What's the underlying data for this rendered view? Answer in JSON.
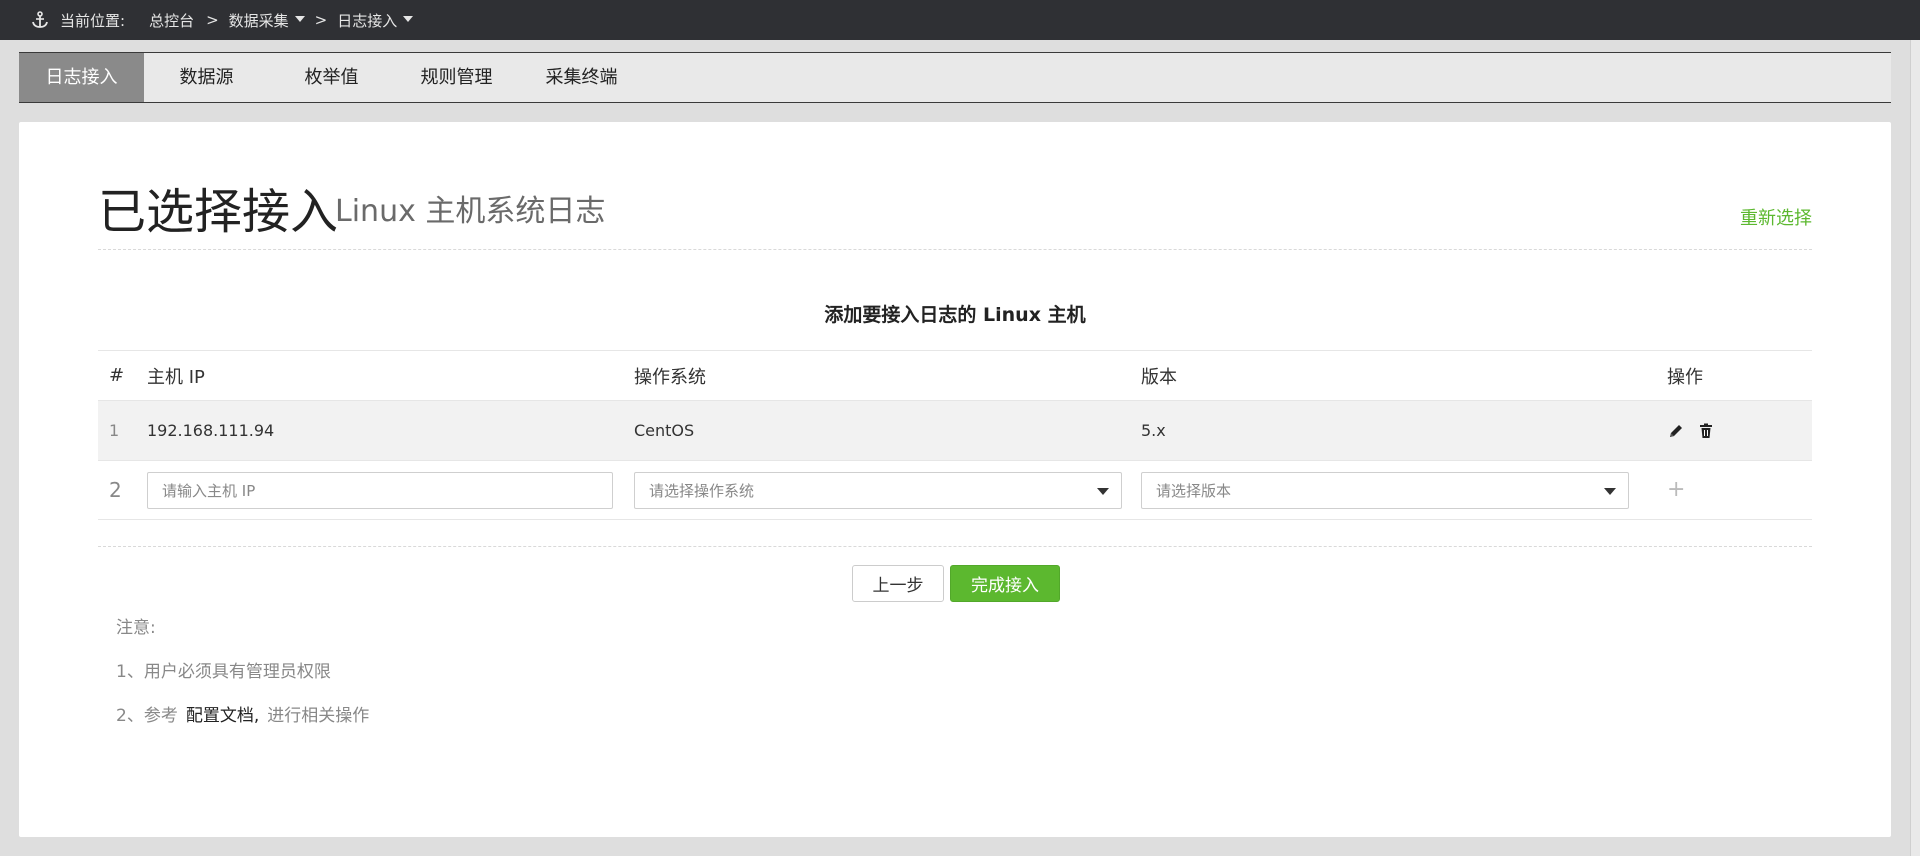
{
  "topbar": {
    "location_label": "当前位置:",
    "crumbs": [
      "总控台",
      "数据采集",
      "日志接入"
    ],
    "separator": ">"
  },
  "tabs": [
    "日志接入",
    "数据源",
    "枚举值",
    "规则管理",
    "采集终端"
  ],
  "active_tab": 0,
  "page": {
    "title": "已选择接入",
    "subtitle": "Linux 主机系统日志",
    "reselect": "重新选择"
  },
  "table": {
    "caption": "添加要接入日志的 Linux 主机",
    "headers": {
      "index": "#",
      "ip": "主机 IP",
      "os": "操作系统",
      "version": "版本",
      "action": "操作"
    },
    "rows": [
      {
        "index": "1",
        "ip": "192.168.111.94",
        "os": "CentOS",
        "version": "5.x"
      }
    ],
    "new_row": {
      "index": "2",
      "ip_placeholder": "请输入主机 IP",
      "os_placeholder": "请选择操作系统",
      "version_placeholder": "请选择版本"
    }
  },
  "buttons": {
    "prev": "上一步",
    "done": "完成接入"
  },
  "notes": {
    "heading": "注意:",
    "line1": "1、用户必须具有管理员权限",
    "line2_prefix": "2、参考",
    "line2_link": "配置文档,",
    "line2_suffix": "进行相关操作"
  },
  "colors": {
    "accent": "#5cb82f",
    "topbar": "#2f3034",
    "active_tab": "#8a8a8a"
  }
}
